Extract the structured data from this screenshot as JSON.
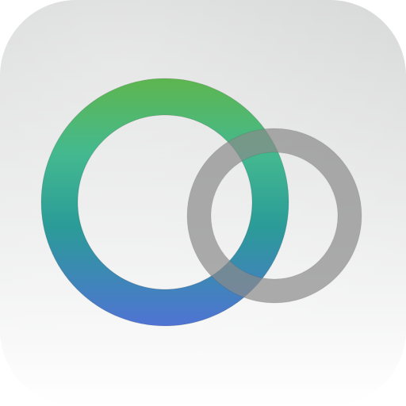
{
  "app_icon": {
    "icon_name": "overlapping-rings-icon",
    "colors": {
      "tile_top": "#d4d5d5",
      "tile_bottom": "#ffffff",
      "ring_green": "#5db64f",
      "ring_teal_light": "#44b98f",
      "ring_teal": "#2b9b98",
      "ring_blue": "#4f74d3",
      "ring_gray": "#8a8a8a"
    }
  }
}
